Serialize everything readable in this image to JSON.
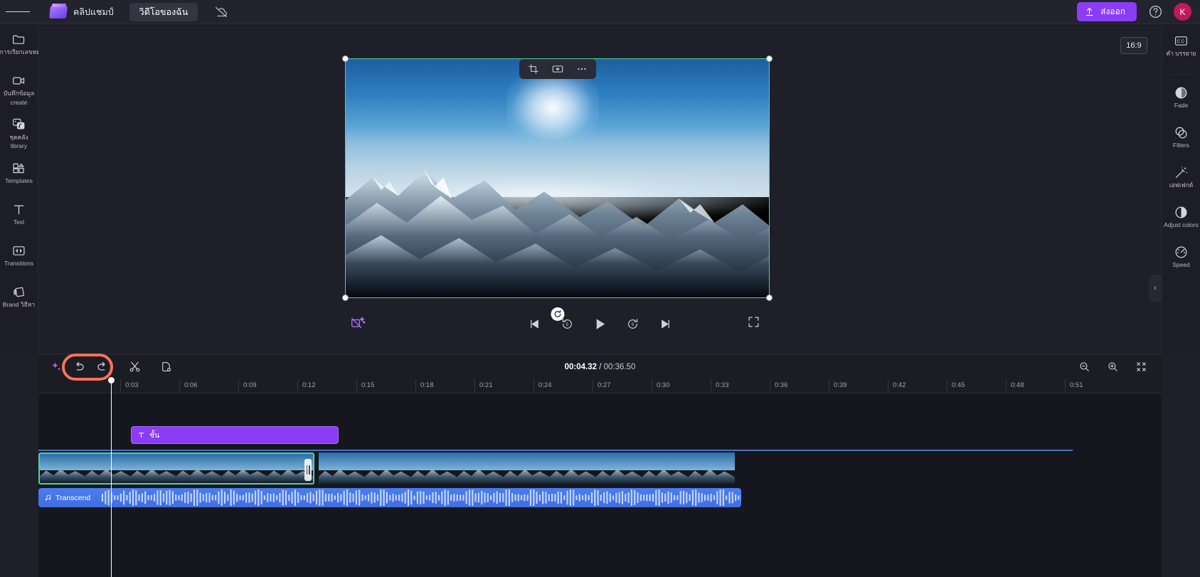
{
  "topbar": {
    "menu_icon": "hamburger-menu-icon",
    "logo_icon": "clipchamp-logo-icon",
    "logo_text": "คลิปแชมป์",
    "project_tab": "วิดีโอของฉัน",
    "cloud_status_icon": "cloud-off-icon",
    "export_label": "ส่งออก",
    "export_icon": "upload-icon",
    "export_color": "#8b3cf6",
    "help_icon": "help-circle-icon",
    "avatar_initial": "K",
    "avatar_color": "#c2185b"
  },
  "left_rail": {
    "items": [
      {
        "icon": "folder-icon",
        "label": "การเรียกเลขหมายซ้ำของคุณ",
        "thai": true
      },
      {
        "icon": "video-camera-icon",
        "label": "บันทึกข้อมูล",
        "label2": "create",
        "thai": true
      },
      {
        "icon": "library-media-icon",
        "label": "ชุดคลัง",
        "label2": "library",
        "thai": true
      },
      {
        "icon": "templates-grid-icon",
        "label": "Templates",
        "thai": false
      },
      {
        "icon": "text-t-icon",
        "label": "Text",
        "thai": false
      },
      {
        "icon": "transitions-icon",
        "label": "Transitions",
        "thai": false
      },
      {
        "icon": "brand-kit-icon",
        "label": "Brand วิธีหา",
        "thai": true
      }
    ],
    "collapse_icon": "chevron-right-icon"
  },
  "right_rail": {
    "items": [
      {
        "icon": "closed-caption-icon",
        "label": "คำ บรรยาย",
        "thai": true
      },
      {
        "icon": "fade-circle-icon",
        "label": "Fade",
        "thai": false
      },
      {
        "icon": "filters-circles-icon",
        "label": "Filters",
        "thai": false
      },
      {
        "icon": "effects-wand-icon",
        "label": "เอฟเฟกต์",
        "thai": true
      },
      {
        "icon": "adjust-colors-icon",
        "label": "Adjust colors",
        "thai": false
      },
      {
        "icon": "speed-gauge-icon",
        "label": "Speed",
        "thai": false
      }
    ],
    "collapse_icon": "chevron-left-icon"
  },
  "preview": {
    "aspect_ratio": "16:9",
    "float_toolbar": [
      {
        "icon": "crop-icon"
      },
      {
        "icon": "fit-resize-icon"
      },
      {
        "icon": "more-horizontal-icon"
      }
    ],
    "selection_color": "#4fd1a5",
    "rotate_icon": "rotate-icon",
    "magic_icon": "magic-camera-icon",
    "transport": [
      {
        "icon": "skip-to-start-icon"
      },
      {
        "icon": "rewind-5-icon"
      },
      {
        "icon": "play-icon"
      },
      {
        "icon": "forward-5-icon"
      },
      {
        "icon": "skip-to-end-icon"
      }
    ],
    "fullscreen_icon": "fullscreen-icon",
    "panel_chevron_icon": "chevron-down-icon"
  },
  "timeline": {
    "toolbar_left": [
      {
        "icon": "ai-sparkle-icon"
      },
      {
        "icon": "undo-icon"
      },
      {
        "icon": "redo-icon"
      },
      {
        "icon": "split-scissors-icon"
      },
      {
        "icon": "duplicate-icon"
      }
    ],
    "current_time": "00:04.32",
    "separator": "/",
    "total_time": "00:36.50",
    "toolbar_right": [
      {
        "icon": "zoom-out-icon"
      },
      {
        "icon": "zoom-in-icon"
      },
      {
        "icon": "fit-timeline-icon"
      }
    ],
    "ruler_ticks": [
      "0:03",
      "0:06",
      "0:09",
      "0:12",
      "0:15",
      "0:18",
      "0:21",
      "0:24",
      "0:27",
      "0:30",
      "0:33",
      "0:36",
      "0:39",
      "0:42",
      "0:45",
      "0:48",
      "0:51"
    ],
    "text_clip": {
      "icon": "text-t-icon",
      "label": "ชั้น",
      "color": "#8b3cf6"
    },
    "audio_clip": {
      "icon": "music-note-icon",
      "label": "Transcend",
      "color": "#4a7df0"
    },
    "annotation_color": "#fb7158"
  }
}
